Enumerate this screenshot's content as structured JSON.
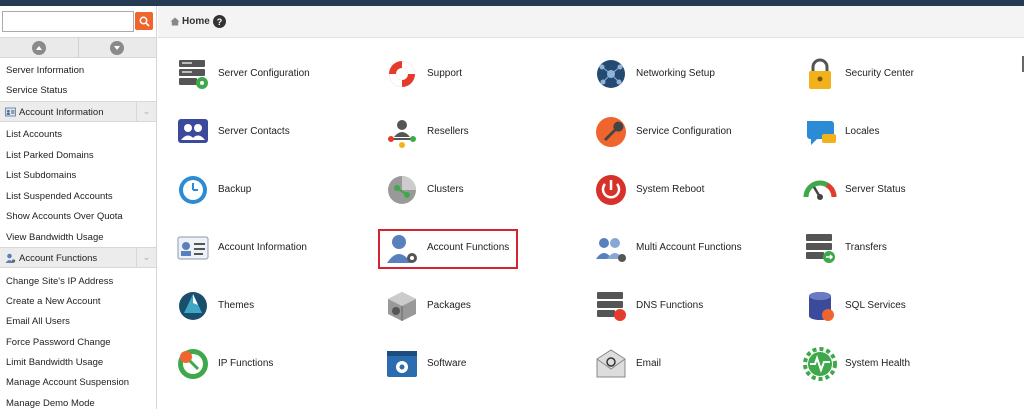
{
  "sidebar": {
    "search": {
      "value": "",
      "placeholder": ""
    },
    "items_top": [
      "Server Information",
      "Service Status"
    ],
    "section_account_info": {
      "label": "Account Information",
      "chevron": "⌄"
    },
    "items_account_info": [
      "List Accounts",
      "List Parked Domains",
      "List Subdomains",
      "List Suspended Accounts",
      "Show Accounts Over Quota",
      "View Bandwidth Usage"
    ],
    "section_account_functions": {
      "label": "Account Functions",
      "chevron": "⌄"
    },
    "items_account_functions": [
      "Change Site's IP Address",
      "Create a New Account",
      "Email All Users",
      "Force Password Change",
      "Limit Bandwidth Usage",
      "Manage Account Suspension",
      "Manage Demo Mode"
    ]
  },
  "breadcrumb": {
    "home": "Home",
    "help": "?"
  },
  "tiles": [
    [
      "Server Configuration",
      "Support",
      "Networking Setup",
      "Security Center"
    ],
    [
      "Server Contacts",
      "Resellers",
      "Service Configuration",
      "Locales"
    ],
    [
      "Backup",
      "Clusters",
      "System Reboot",
      "Server Status"
    ],
    [
      "Account Information",
      "Account Functions",
      "Multi Account Functions",
      "Transfers"
    ],
    [
      "Themes",
      "Packages",
      "DNS Functions",
      "SQL Services"
    ],
    [
      "IP Functions",
      "Software",
      "Email",
      "System Health"
    ]
  ],
  "icons": [
    [
      "server-config-icon",
      "support-lifebuoy-icon",
      "networking-icon",
      "padlock-icon"
    ],
    [
      "contacts-icon",
      "resellers-icon",
      "wrench-icon",
      "locales-icon"
    ],
    [
      "backup-icon",
      "clusters-icon",
      "power-icon",
      "gauge-icon"
    ],
    [
      "id-card-icon",
      "user-gear-icon",
      "users-gear-icon",
      "transfers-icon"
    ],
    [
      "themes-icon",
      "package-icon",
      "dns-server-icon",
      "database-icon"
    ],
    [
      "ip-icon",
      "software-window-icon",
      "email-icon",
      "health-gear-icon"
    ]
  ],
  "selected_tile": "Account Functions",
  "colors": {
    "accent": "#f0642e",
    "highlight": "#d6232f",
    "topbar": "#253a55"
  }
}
